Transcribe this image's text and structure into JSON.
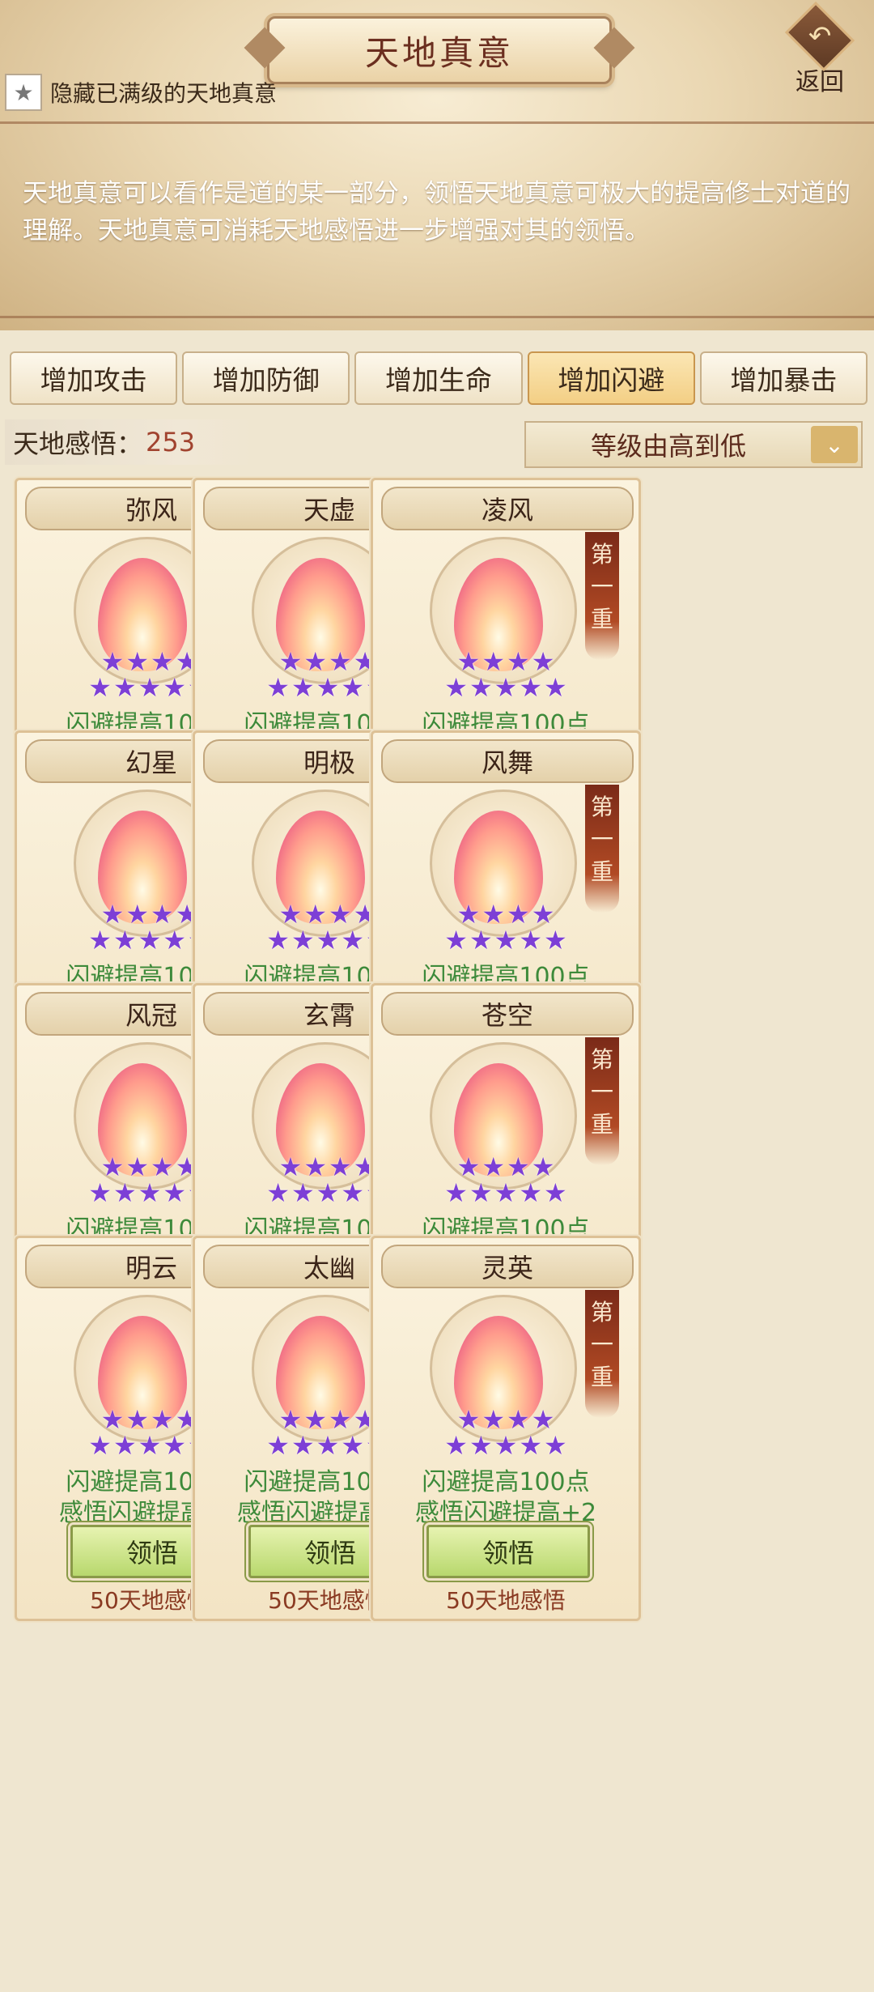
{
  "header": {
    "title": "天地真意",
    "back_label": "返回",
    "hide_label": "隐藏已满级的天地真意",
    "description": "天地真意可以看作是道的某一部分，领悟天地真意可极大的提高修士对道的理解。天地真意可消耗天地感悟进一步增强对其的领悟。"
  },
  "tabs": [
    {
      "label": "增加攻击",
      "active": false
    },
    {
      "label": "增加防御",
      "active": false
    },
    {
      "label": "增加生命",
      "active": false
    },
    {
      "label": "增加闪避",
      "active": true
    },
    {
      "label": "增加暴击",
      "active": false
    }
  ],
  "points": {
    "label": "天地感悟：",
    "value": "253"
  },
  "sort": {
    "label": "等级由高到低"
  },
  "card_common": {
    "level": "第一重",
    "effect1": "闪避提高100点",
    "effect2": "感悟闪避提高+2",
    "button": "领悟",
    "cost": "50天地感悟",
    "stars": 9,
    "star_color": "#7d3fd6"
  },
  "cards": [
    {
      "name": "弥风"
    },
    {
      "name": "天虚"
    },
    {
      "name": "凌风"
    },
    {
      "name": "幻星"
    },
    {
      "name": "明极"
    },
    {
      "name": "风舞"
    },
    {
      "name": "风冠"
    },
    {
      "name": "玄霄"
    },
    {
      "name": "苍空"
    },
    {
      "name": "明云"
    },
    {
      "name": "太幽"
    },
    {
      "name": "灵英"
    }
  ]
}
